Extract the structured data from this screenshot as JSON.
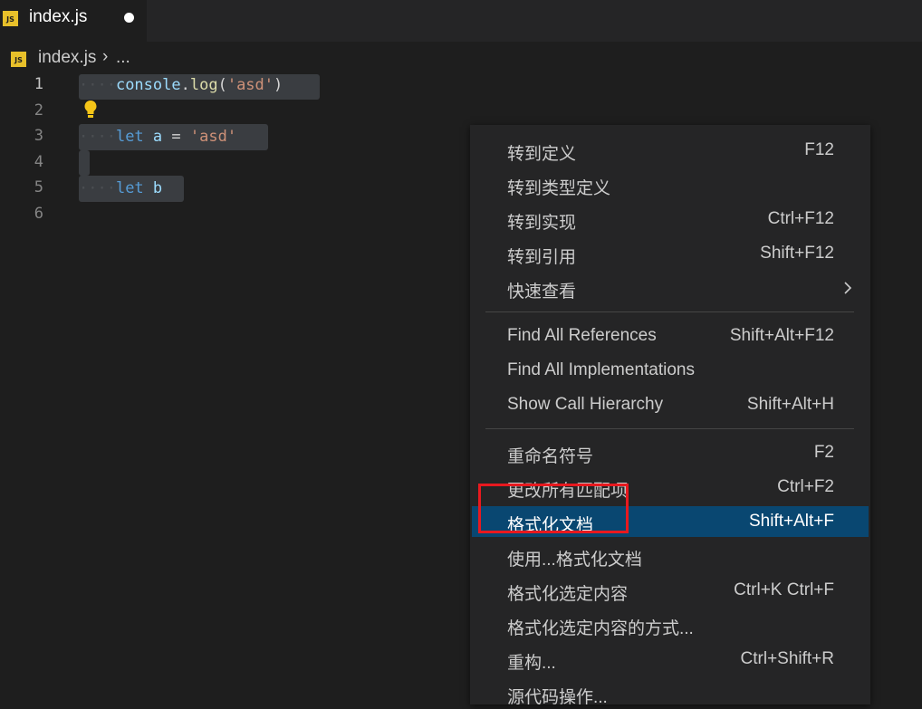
{
  "tab": {
    "title": "index.js",
    "icon": "js-file-icon",
    "icon_text": "JS",
    "modified": true
  },
  "breadcrumb": {
    "file": "index.js",
    "separator": "›",
    "more": "..."
  },
  "editor": {
    "active_line": 1,
    "line_numbers": [
      "1",
      "2",
      "3",
      "4",
      "5",
      "6"
    ],
    "lines": [
      {
        "indent": "····",
        "tokens": [
          "console",
          ".",
          "log",
          "(",
          "'asd'",
          ")"
        ]
      },
      {
        "indent": "",
        "tokens": []
      },
      {
        "indent": "····",
        "tokens": [
          "let",
          " ",
          "a",
          " ",
          "=",
          " ",
          "'asd'"
        ]
      },
      {
        "indent": "",
        "tokens": []
      },
      {
        "indent": "····",
        "tokens": [
          "let",
          " ",
          "b"
        ]
      },
      {
        "indent": "",
        "tokens": []
      }
    ],
    "lightbulb_icon": "lightbulb-icon"
  },
  "context_menu": {
    "groups": [
      [
        {
          "label": "转到定义",
          "shortcut": "F12"
        },
        {
          "label": "转到类型定义",
          "shortcut": ""
        },
        {
          "label": "转到实现",
          "shortcut": "Ctrl+F12"
        },
        {
          "label": "转到引用",
          "shortcut": "Shift+F12"
        },
        {
          "label": "快速查看",
          "shortcut": "",
          "submenu": true
        }
      ],
      [
        {
          "label": "Find All References",
          "shortcut": "Shift+Alt+F12"
        },
        {
          "label": "Find All Implementations",
          "shortcut": ""
        },
        {
          "label": "Show Call Hierarchy",
          "shortcut": "Shift+Alt+H"
        }
      ],
      [
        {
          "label": "重命名符号",
          "shortcut": "F2"
        },
        {
          "label": "更改所有匹配项",
          "shortcut": "Ctrl+F2"
        },
        {
          "label": "格式化文档",
          "shortcut": "Shift+Alt+F",
          "selected": true
        },
        {
          "label": "使用...格式化文档",
          "shortcut": ""
        },
        {
          "label": "格式化选定内容",
          "shortcut": "Ctrl+K Ctrl+F"
        },
        {
          "label": "格式化选定内容的方式...",
          "shortcut": ""
        },
        {
          "label": "重构...",
          "shortcut": "Ctrl+Shift+R"
        },
        {
          "label": "源代码操作...",
          "shortcut": ""
        }
      ]
    ],
    "selected_color": "#094771",
    "annotation_color": "#e8191f"
  }
}
